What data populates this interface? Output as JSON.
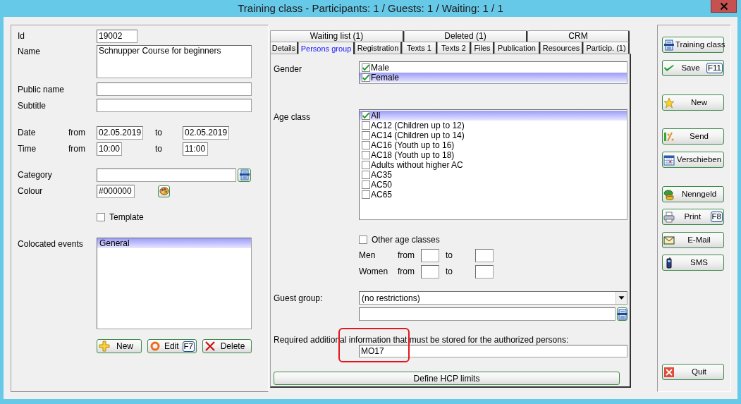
{
  "window": {
    "title": "Training class - Participants: 1 / Guests: 1 / Waiting: 1 / 1"
  },
  "details": {
    "id": {
      "label": "Id",
      "value": "19002"
    },
    "name": {
      "label": "Name",
      "value": "Schnupper Course for beginners"
    },
    "public_name": {
      "label": "Public name"
    },
    "subtitle": {
      "label": "Subtitle"
    },
    "date": {
      "label": "Date",
      "from_label": "from",
      "from": "02.05.2019",
      "to_label": "to",
      "to": "02.05.2019"
    },
    "time": {
      "label": "Time",
      "from_label": "from",
      "from": "10:00",
      "to_label": "to",
      "to": "11:00"
    },
    "category": {
      "label": "Category"
    },
    "colour": {
      "label": "Colour",
      "value": "#000000"
    },
    "template": {
      "label": "Template",
      "checked": false
    },
    "colocated_events": {
      "label": "Colocated events",
      "items": [
        {
          "label": "General",
          "selected": true
        }
      ]
    },
    "buttons": [
      {
        "label": "New"
      },
      {
        "label": "Edit",
        "shortcut": "F7"
      },
      {
        "label": "Delete"
      }
    ]
  },
  "tab_rows": [
    {
      "tabs": [
        {
          "label": "Waiting list (1)",
          "selected": false
        },
        {
          "label": "Deleted (1)",
          "selected": false
        },
        {
          "label": "CRM",
          "selected": false
        }
      ]
    },
    {
      "tabs": [
        {
          "label": "Details",
          "selected": false
        },
        {
          "label": "Persons group",
          "selected": true
        },
        {
          "label": "Registration",
          "selected": false
        },
        {
          "label": "Texts 1",
          "selected": false
        },
        {
          "label": "Texts 2",
          "selected": false
        },
        {
          "label": "Files",
          "selected": false
        },
        {
          "label": "Publication",
          "selected": false
        },
        {
          "label": "Resources",
          "selected": false
        },
        {
          "label": "Particip. (1)",
          "selected": false
        }
      ]
    }
  ],
  "persons_group": {
    "gender": {
      "label": "Gender",
      "items": [
        {
          "label": "Male",
          "checked": true,
          "selected": false
        },
        {
          "label": "Female",
          "checked": true,
          "selected": true
        }
      ]
    },
    "age_class": {
      "label": "Age class",
      "items": [
        {
          "label": "All",
          "checked": true,
          "selected": true
        },
        {
          "label": "AC12 (Children up to 12)",
          "checked": false,
          "selected": false
        },
        {
          "label": "AC14 (Children up to 14)",
          "checked": false,
          "selected": false
        },
        {
          "label": "AC16 (Youth up to 16)",
          "checked": false,
          "selected": false
        },
        {
          "label": "AC18 (Youth up to 18)",
          "checked": false,
          "selected": false
        },
        {
          "label": "Adults without higher AC",
          "checked": false,
          "selected": false
        },
        {
          "label": "AC35",
          "checked": false,
          "selected": false
        },
        {
          "label": "AC50",
          "checked": false,
          "selected": false
        },
        {
          "label": "AC65",
          "checked": false,
          "selected": false
        }
      ]
    },
    "other_age_classes": {
      "label": "Other age classes",
      "checked": false
    },
    "age_ranges": [
      {
        "label": "Men",
        "from_label": "from",
        "to_label": "to"
      },
      {
        "label": "Women",
        "from_label": "from",
        "to_label": "to"
      }
    ],
    "guest_group": {
      "label": "Guest group:",
      "value": "(no restrictions)"
    },
    "required_info": {
      "label": "Required additional information that must be stored for the authorized persons:",
      "value": "MO17"
    },
    "hcp_button": {
      "label": "Define HCP limits"
    }
  },
  "sidebar": {
    "buttons": [
      {
        "label": "Training class"
      },
      {
        "label": "Save",
        "shortcut": "F11"
      },
      {
        "label": "New"
      },
      {
        "label": "Send"
      },
      {
        "label": "Verschieben"
      },
      {
        "label": "Nenngeld"
      },
      {
        "label": "Print",
        "shortcut": "F8"
      },
      {
        "label": "E-Mail"
      },
      {
        "label": "SMS"
      },
      {
        "label": "Quit"
      }
    ]
  }
}
